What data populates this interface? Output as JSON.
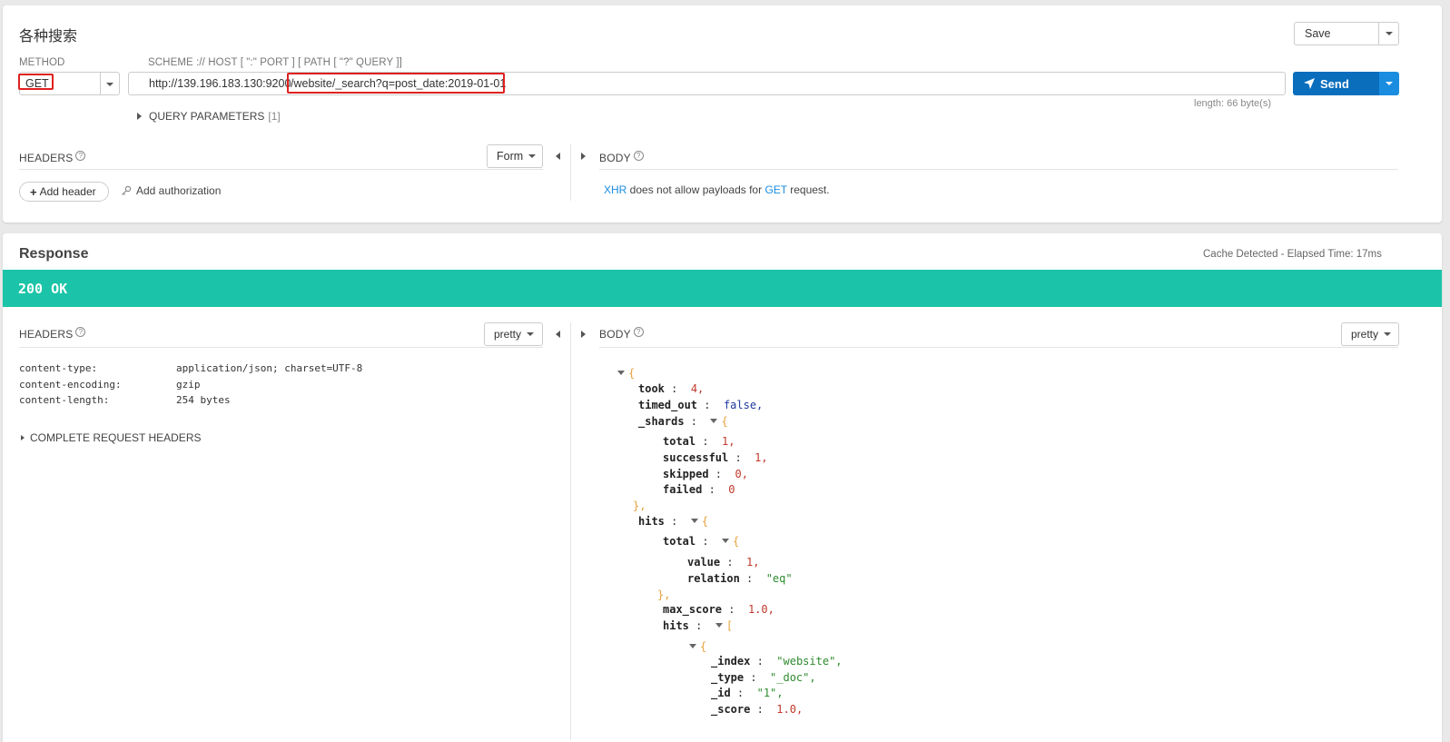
{
  "request": {
    "title": "各种搜索",
    "save_label": "Save",
    "method_label": "METHOD",
    "method_value": "GET",
    "scheme_label": "SCHEME :// HOST [ \":\" PORT ] [ PATH [ \"?\" QUERY ]]",
    "url_host": "http://139.196.183.130:9200",
    "url_path": "/website/_search?q=post_date:2019-01-01",
    "send_label": "Send",
    "length_text": "length: 66 byte(s)",
    "query_params_label": "QUERY PARAMETERS",
    "query_params_count": "[1]",
    "headers_label": "HEADERS",
    "headers_help": "?",
    "form_label": "Form",
    "add_header_label": "Add header",
    "add_auth_label": "Add authorization",
    "body_label": "BODY",
    "body_help": "?",
    "body_msg_xhr": "XHR",
    "body_msg_mid": " does not allow payloads for ",
    "body_msg_get": "GET",
    "body_msg_end": " request."
  },
  "response": {
    "title": "Response",
    "elapsed": "Cache Detected - Elapsed Time: 17ms",
    "status": "200 OK",
    "status_color": "#1bc4a8",
    "headers_label": "HEADERS",
    "headers_help": "?",
    "pretty_label": "pretty",
    "body_label": "BODY",
    "body_help": "?",
    "body_pretty_label": "pretty",
    "headers": [
      {
        "name": "content-type:",
        "value": "application/json; charset=UTF-8"
      },
      {
        "name": "content-encoding:",
        "value": "gzip"
      },
      {
        "name": "content-length:",
        "value": "254 bytes"
      }
    ],
    "complete_headers_label": "COMPLETE REQUEST HEADERS"
  },
  "json_lines": [
    {
      "type": "open",
      "text": "{",
      "fold": true
    },
    {
      "type": "kv",
      "key": "took",
      "value": "4,",
      "vtype": "num"
    },
    {
      "type": "kv",
      "key": "timed_out",
      "value": "false,",
      "vtype": "bool"
    },
    {
      "type": "kopen",
      "key": "_shards",
      "text": "{"
    },
    {
      "type": "kv",
      "key": "total",
      "value": "1,",
      "vtype": "num"
    },
    {
      "type": "kv",
      "key": "successful",
      "value": "1,",
      "vtype": "num"
    },
    {
      "type": "kv",
      "key": "skipped",
      "value": "0,",
      "vtype": "num"
    },
    {
      "type": "kv",
      "key": "failed",
      "value": "0",
      "vtype": "num"
    },
    {
      "type": "close",
      "text": "},"
    },
    {
      "type": "kopen",
      "key": "hits",
      "text": "{"
    },
    {
      "type": "kopen",
      "key": "total",
      "text": "{"
    },
    {
      "type": "kv",
      "key": "value",
      "value": "1,",
      "vtype": "num"
    },
    {
      "type": "kv",
      "key": "relation",
      "value": "\"eq\"",
      "vtype": "str"
    },
    {
      "type": "close",
      "text": "},"
    },
    {
      "type": "kv",
      "key": "max_score",
      "value": "1.0,",
      "vtype": "num"
    },
    {
      "type": "kopen",
      "key": "hits",
      "text": "["
    },
    {
      "type": "open",
      "text": "{",
      "fold": true
    },
    {
      "type": "kv",
      "key": "_index",
      "value": "\"website\",",
      "vtype": "str"
    },
    {
      "type": "kv",
      "key": "_type",
      "value": "\"_doc\",",
      "vtype": "str"
    },
    {
      "type": "kv",
      "key": "_id",
      "value": "\"1\",",
      "vtype": "str"
    },
    {
      "type": "kv",
      "key": "_score",
      "value": "1.0,",
      "vtype": "num"
    }
  ]
}
